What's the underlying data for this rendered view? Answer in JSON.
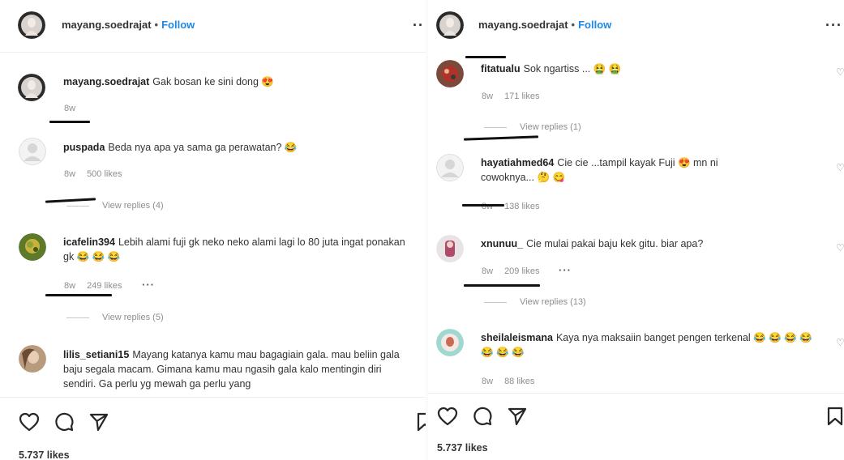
{
  "colors": {
    "follow": "#1d88e6",
    "meta": "#8e8e8e",
    "text": "#262626"
  },
  "left": {
    "header": {
      "username": "mayang.soedrajat",
      "separator": "•",
      "follow": "Follow",
      "more": "··"
    },
    "caption": {
      "user": "mayang.soedrajat",
      "text": "Gak bosan ke sini dong 😍",
      "time": "8w"
    },
    "comments": [
      {
        "user": "puspada",
        "text": "Beda nya apa ya sama ga perawatan? 😂",
        "time": "8w",
        "likes": "500 likes",
        "replies": "View replies (4)"
      },
      {
        "user": "icafelin394",
        "text": "Lebih alami fuji gk neko neko alami lagi lo 80 juta ingat ponakan gk 😂 😂 😂",
        "time": "8w",
        "likes": "249 likes",
        "more": "···",
        "replies": "View replies (5)"
      },
      {
        "user": "lilis_setiani15",
        "text": "Mayang katanya kamu mau bagagiain gala. mau beliin gala baju segala macam. Gimana kamu mau ngasih gala kalo mentingin diri sendiri. Ga perlu yg mewah ga perlu yang"
      }
    ],
    "likes": "5.737 likes",
    "icons": [
      "heart-icon",
      "comment-icon",
      "share-icon",
      "bookmark-icon"
    ]
  },
  "right": {
    "header": {
      "username": "mayang.soedrajat",
      "separator": "•",
      "follow": "Follow",
      "more": "···"
    },
    "comments": [
      {
        "user": "fitatualu",
        "text": "Sok ngartiss ... 🤮 🤮",
        "time": "8w",
        "likes": "171 likes",
        "replies": "View replies (1)"
      },
      {
        "user": "hayatiahmed64",
        "text": "Cie cie ...tampil kayak Fuji 😍 mn ni cowoknya... 🤔 😋",
        "time": "8w",
        "likes": "138 likes"
      },
      {
        "user": "xnunuu_",
        "text": "Cie mulai pakai baju kek gitu. biar apa?",
        "time": "8w",
        "likes": "209 likes",
        "more": "···",
        "replies": "View replies (13)"
      },
      {
        "user": "sheilaleismana",
        "text": "Kaya nya maksaiin banget pengen terkenal 😂 😂 😂 😂 😂 😂 😂",
        "time": "8w",
        "likes": "88 likes"
      }
    ],
    "likes": "5.737 likes",
    "icons": [
      "heart-icon",
      "comment-icon",
      "share-icon",
      "bookmark-icon"
    ]
  }
}
